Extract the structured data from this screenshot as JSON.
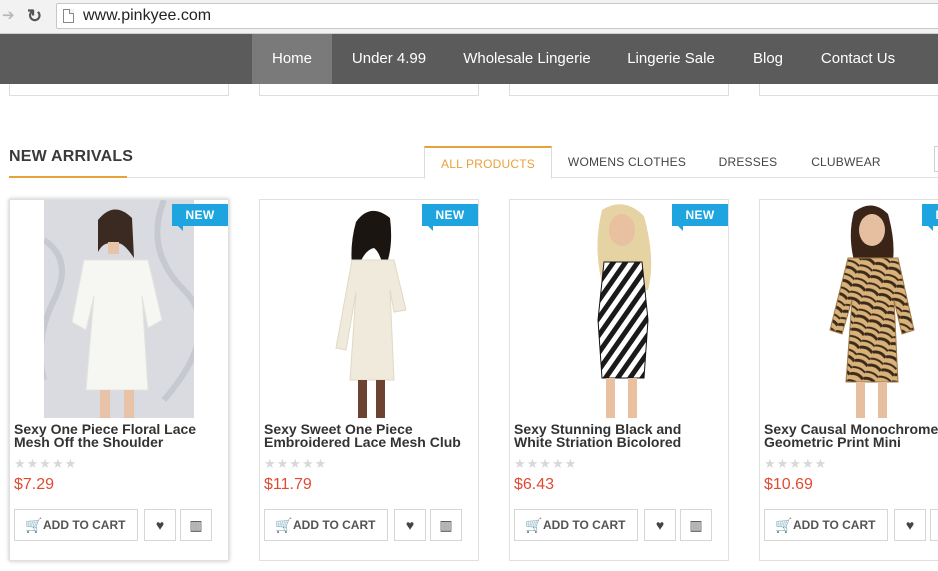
{
  "browser": {
    "url": "www.pinkyee.com"
  },
  "nav": {
    "items": [
      "Home",
      "Under 4.99",
      "Wholesale Lingerie",
      "Lingerie Sale",
      "Blog",
      "Contact Us"
    ],
    "active": "Home"
  },
  "section": {
    "title": "NEW ARRIVALS",
    "tabs": [
      "ALL PRODUCTS",
      "WOMENS CLOTHES",
      "DRESSES",
      "CLUBWEAR"
    ],
    "active_tab": "ALL PRODUCTS"
  },
  "products": [
    {
      "badge": "NEW",
      "title_line1": "Sexy One Piece Floral Lace",
      "title_line2": "Mesh Off the Shoulder",
      "rating": 0,
      "price": "$7.29",
      "cart_label": "ADD TO CART"
    },
    {
      "badge": "NEW",
      "title_line1": "Sexy Sweet One Piece",
      "title_line2": "Embroidered Lace Mesh Club",
      "rating": 0,
      "price": "$11.79",
      "cart_label": "ADD TO CART"
    },
    {
      "badge": "NEW",
      "title_line1": "Sexy Stunning Black and",
      "title_line2": "White Striation Bicolored",
      "rating": 0,
      "price": "$6.43",
      "cart_label": "ADD TO CART"
    },
    {
      "badge": "NEW",
      "title_line1": "Sexy Causal Monochrome",
      "title_line2": "Geometric Print Mini",
      "rating": 0,
      "price": "$10.69",
      "cart_label": "ADD TO CART"
    }
  ],
  "icons": {
    "back": "back-arrow-icon",
    "reload": "reload-icon",
    "page": "page-icon",
    "cart": "cart-icon",
    "wishlist": "heart-icon",
    "compare": "bar-chart-icon",
    "star": "star-icon"
  },
  "colors": {
    "nav_bg": "#5b5b5b",
    "nav_active": "#7a7a7a",
    "accent": "#e8a23a",
    "badge": "#1ea5e0",
    "price": "#e14a33"
  }
}
